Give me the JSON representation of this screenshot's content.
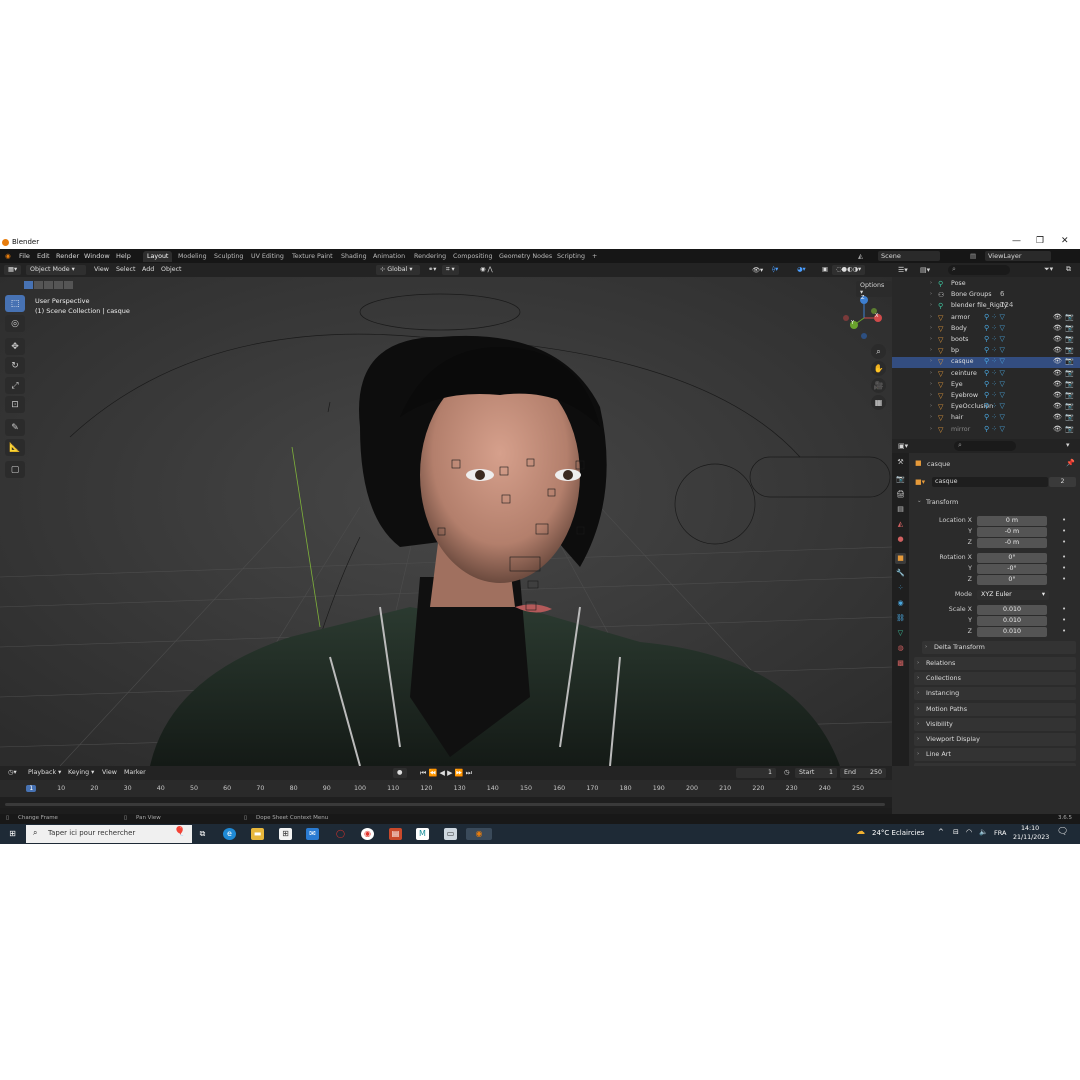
{
  "window": {
    "app_title": "Blender",
    "min": "—",
    "max": "❐",
    "close": "✕"
  },
  "menu": {
    "items": [
      "File",
      "Edit",
      "Render",
      "Window",
      "Help"
    ],
    "workspaces": [
      "Layout",
      "Modeling",
      "Sculpting",
      "UV Editing",
      "Texture Paint",
      "Shading",
      "Animation",
      "Rendering",
      "Compositing",
      "Geometry Nodes",
      "Scripting",
      "+"
    ],
    "scene_label": "Scene",
    "view_layer_label": "ViewLayer"
  },
  "viewport_header": {
    "mode": "Object Mode",
    "view": "View",
    "select": "Select",
    "add": "Add",
    "object": "Object",
    "orientation": "Global",
    "options": "Options"
  },
  "viewport": {
    "perspective": "User Perspective",
    "collection": "(1) Scene Collection | casque",
    "gizmo": {
      "z": "Z",
      "y": "Y",
      "x": "X"
    }
  },
  "outliner": {
    "rows": [
      {
        "name": "Pose",
        "icon": "pose-icon",
        "color": "#3ec7a0",
        "selected": false
      },
      {
        "name": "Bone Groups",
        "icon": "bone-groups-icon",
        "color": "#cfcfcf",
        "selected": false,
        "extra": "6"
      },
      {
        "name": "blender file_Rigify",
        "icon": "armature-icon",
        "color": "#3ec7a0",
        "selected": false,
        "extra": "124"
      },
      {
        "name": "armor",
        "icon": "mesh-icon",
        "color": "#e69a3a",
        "selected": false
      },
      {
        "name": "Body",
        "icon": "mesh-icon",
        "color": "#e69a3a",
        "selected": false
      },
      {
        "name": "boots",
        "icon": "mesh-icon",
        "color": "#e69a3a",
        "selected": false
      },
      {
        "name": "bp",
        "icon": "mesh-icon",
        "color": "#e69a3a",
        "selected": false
      },
      {
        "name": "casque",
        "icon": "mesh-icon",
        "color": "#e69a3a",
        "selected": true
      },
      {
        "name": "ceinture",
        "icon": "mesh-icon",
        "color": "#e69a3a",
        "selected": false
      },
      {
        "name": "Eye",
        "icon": "mesh-icon",
        "color": "#e69a3a",
        "selected": false
      },
      {
        "name": "Eyebrow",
        "icon": "mesh-icon",
        "color": "#e69a3a",
        "selected": false
      },
      {
        "name": "EyeOcclusion",
        "icon": "mesh-icon",
        "color": "#e69a3a",
        "selected": false
      },
      {
        "name": "hair",
        "icon": "mesh-icon",
        "color": "#e69a3a",
        "selected": false
      },
      {
        "name": "mirror",
        "icon": "mesh-icon",
        "color": "#e69a3a",
        "selected": false
      }
    ]
  },
  "properties": {
    "object_name": "casque",
    "data_name": "casque",
    "users": "2",
    "transform_label": "Transform",
    "location_label": "Location X",
    "location": {
      "x": "0 m",
      "y": "-0 m",
      "z": "-0 m"
    },
    "rotation_label": "Rotation X",
    "rotation": {
      "x": "0°",
      "y": "-0°",
      "z": "0°"
    },
    "mode_label": "Mode",
    "mode_value": "XYZ Euler",
    "scale_label": "Scale X",
    "scale": {
      "x": "0.010",
      "y": "0.010",
      "z": "0.010"
    },
    "axis_y": "Y",
    "axis_z": "Z",
    "delta": "Delta Transform",
    "sections": [
      "Relations",
      "Collections",
      "Instancing",
      "Motion Paths",
      "Visibility",
      "Viewport Display",
      "Line Art",
      "Custom Properties"
    ]
  },
  "timeline": {
    "menu": [
      "Playback",
      "Keying",
      "View",
      "Marker"
    ],
    "current_frame": "1",
    "start_label": "Start",
    "start": "1",
    "end_label": "End",
    "end": "250",
    "ticks": [
      "1",
      "10",
      "20",
      "30",
      "40",
      "50",
      "60",
      "70",
      "80",
      "90",
      "100",
      "110",
      "120",
      "130",
      "140",
      "150",
      "160",
      "170",
      "180",
      "190",
      "200",
      "210",
      "220",
      "230",
      "240",
      "250"
    ]
  },
  "status": {
    "change_frame": "Change Frame",
    "pan_view": "Pan View",
    "context_menu": "Dope Sheet Context Menu",
    "version": "3.6.5"
  },
  "taskbar": {
    "search_placeholder": "Taper ici pour rechercher",
    "weather": "24°C  Eclaircies",
    "lang": "FRA",
    "time": "14:10",
    "date": "21/11/2023"
  },
  "colors": {
    "accent": "#4772b3",
    "selected_row": "#334d80",
    "mesh": "#e69a3a",
    "armature": "#3ec7a0"
  }
}
